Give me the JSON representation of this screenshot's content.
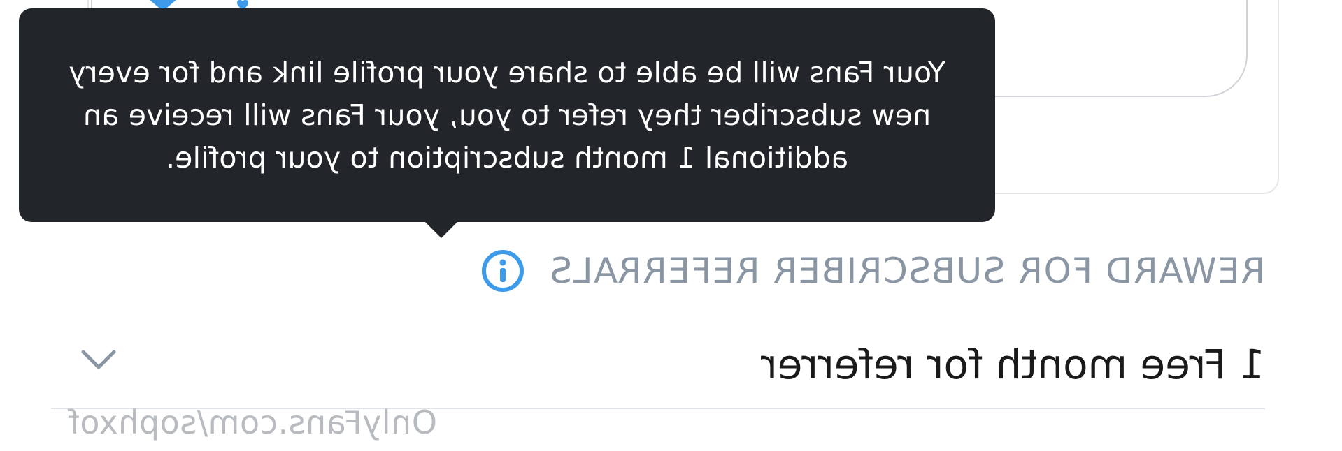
{
  "tooltip": {
    "text": "Your Fans will be able to share your profile link and for every new subscriber they refer to you, your Fans will receive an additional 1 month subscription to your profile."
  },
  "referral_section": {
    "title": "REWARD FOR SUBSCRIBER REFERRALS",
    "info_icon": "info-circle-icon"
  },
  "reward_select": {
    "value": "1 Free month for referrer",
    "icon": "chevron-down-icon"
  },
  "card": {
    "icon": "user-heart-icon"
  },
  "watermark": {
    "text": "OnlyFans.com/sophxof"
  },
  "colors": {
    "tooltip_bg": "#222529",
    "accent_blue": "#3d9be9",
    "muted_text": "#8a96a3"
  }
}
